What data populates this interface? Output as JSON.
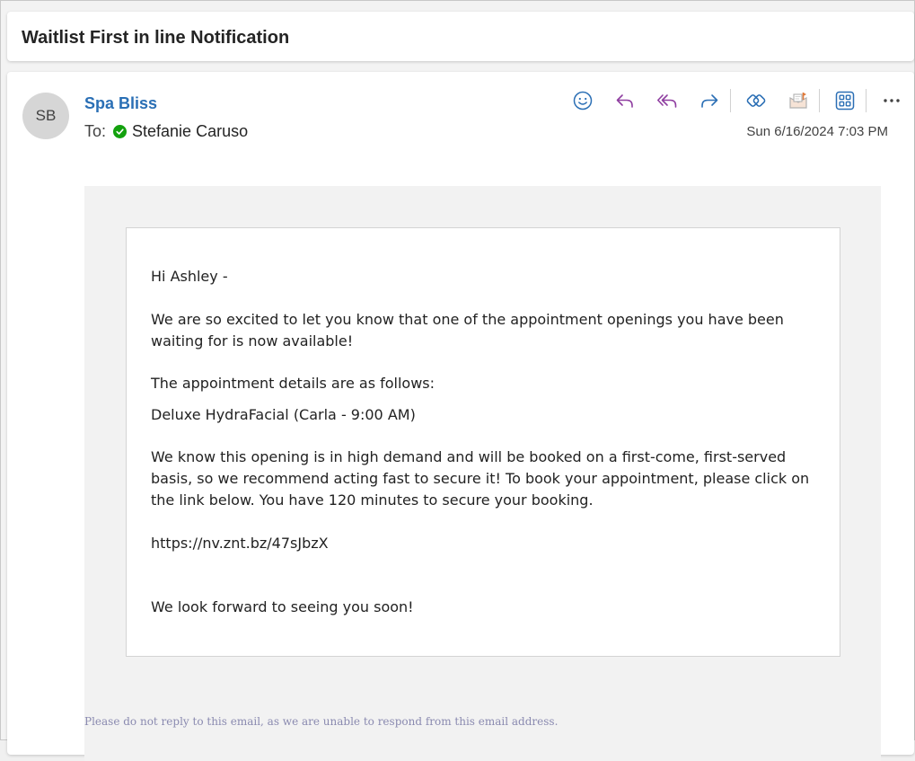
{
  "subject": "Waitlist First in line Notification",
  "sender": {
    "initials": "SB",
    "name": "Spa Bliss"
  },
  "recipient": {
    "label": "To:",
    "name": "Stefanie Caruso"
  },
  "date": "Sun 6/16/2024 7:03 PM",
  "toolbar": {
    "icons": [
      "emoji-icon",
      "reply-icon",
      "reply-all-icon",
      "forward-icon",
      "copilot-icon",
      "report-icon",
      "apps-icon",
      "more-icon"
    ],
    "accent_color": "#8f3ea0",
    "blue_color": "#2b6fb5"
  },
  "message": {
    "greeting": "Hi Ashley -",
    "p1": "We are so excited to let you know that one of the appointment openings you have been waiting for is now available!",
    "p2": "The appointment details are as follows:",
    "p3": "Deluxe HydraFacial (Carla - 9:00 AM)",
    "p4": "We know this opening is in high demand and will be booked on a first-come, first-served basis, so we recommend acting fast to secure it! To book your appointment, please click on the link below. You have 120 minutes to secure your booking.",
    "link": "https://nv.znt.bz/47sJbzX",
    "closing": "We look forward to seeing you soon!"
  },
  "footer": "Please do not reply to this email, as we are unable to respond from this email address."
}
